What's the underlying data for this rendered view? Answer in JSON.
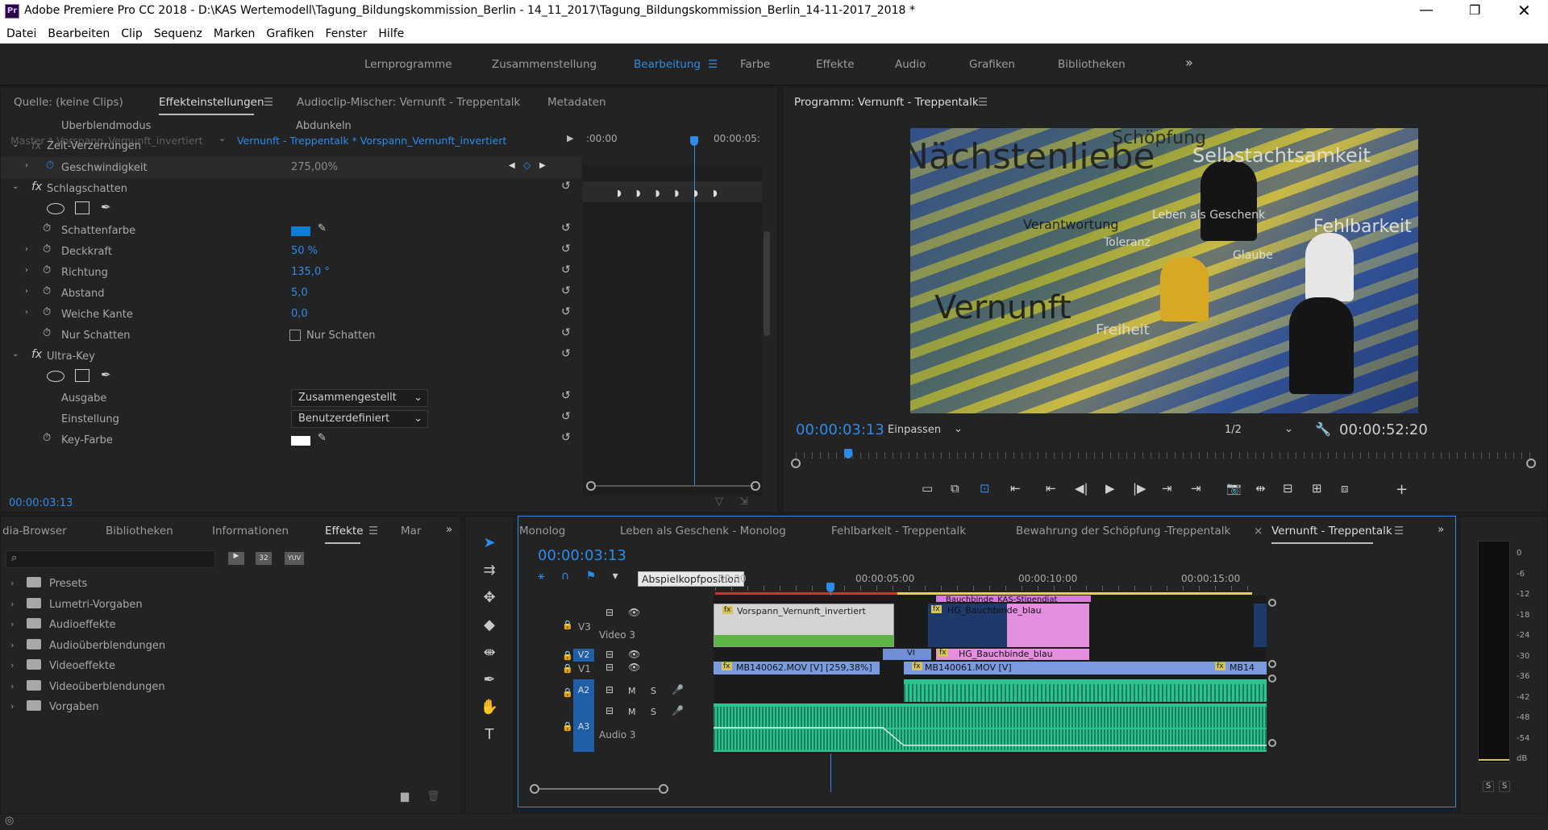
{
  "window": {
    "title": "Adobe Premiere Pro CC 2018 - D:\\KAS Wertemodell\\Tagung_Bildungskommission_Berlin - 14_11_2017\\Tagung_Bildungskommission_Berlin_14-11-2017_2018 *",
    "app_icon": "Pr"
  },
  "menu": [
    "Datei",
    "Bearbeiten",
    "Clip",
    "Sequenz",
    "Marken",
    "Grafiken",
    "Fenster",
    "Hilfe"
  ],
  "workspaces": [
    "Lernprogramme",
    "Zusammenstellung",
    "Bearbeitung",
    "Farbe",
    "Effekte",
    "Audio",
    "Grafiken",
    "Bibliotheken"
  ],
  "workspace_active": "Bearbeitung",
  "source_panel": {
    "tabs": [
      "Quelle: (keine Clips)",
      "Effekteinstellungen",
      "Audioclip-Mischer: Vernunft - Treppentalk",
      "Metadaten"
    ],
    "master_label": "Master * Vorspann_Vernunft_invertiert",
    "clip_label": "Vernunft - Treppentalk * Vorspann_Vernunft_invertiert",
    "time_start": ":00:00",
    "time_end": "00:00:05:",
    "rows": {
      "ueberblendmodus_label": "Überblendmodus",
      "ueberblendmodus_value": "Abdunkeln",
      "zeit_verzerrungen": "Zeit-Verzerrungen",
      "geschwindigkeit_label": "Geschwindigkeit",
      "geschwindigkeit_value": "275,00%",
      "schlagschatten": "Schlagschatten",
      "schattenfarbe": "Schattenfarbe",
      "deckkraft_label": "Deckkraft",
      "deckkraft_value": "50 %",
      "richtung_label": "Richtung",
      "richtung_value": "135,0 °",
      "abstand_label": "Abstand",
      "abstand_value": "5,0",
      "weiche_kante_label": "Weiche Kante",
      "weiche_kante_value": "0,0",
      "nur_schatten_label": "Nur Schatten",
      "nur_schatten_value": "Nur Schatten",
      "ultra_key": "Ultra-Key",
      "ausgabe_label": "Ausgabe",
      "ausgabe_value": "Zusammengestellt",
      "einstellung_label": "Einstellung",
      "einstellung_value": "Benutzerdefiniert",
      "key_farbe_label": "Key-Farbe"
    },
    "timecode": "00:00:03:13",
    "shadow_color": "#0a7fd4"
  },
  "program_panel": {
    "title": "Programm: Vernunft - Treppentalk",
    "timecode": "00:00:03:13",
    "fit": "Einpassen",
    "resolution": "1/2",
    "duration": "00:00:52:20",
    "playhead_fraction": 0.066
  },
  "effects_panel": {
    "tabs": [
      "dia-Browser",
      "Bibliotheken",
      "Informationen",
      "Effekte",
      "Mar"
    ],
    "active_tab": "Effekte",
    "search_placeholder": "",
    "folders": [
      "Presets",
      "Lumetri-Vorgaben",
      "Audioeffekte",
      "Audioüberblendungen",
      "Videoeffekte",
      "Videoüberblendungen",
      "Vorgaben"
    ],
    "badges": [
      "32",
      "YUV"
    ]
  },
  "timeline": {
    "tabs": [
      "Monolog",
      "Leben als Geschenk - Monolog",
      "Fehlbarkeit - Treppentalk",
      "Bewahrung der Schöpfung -Treppentalk",
      "Vernunft - Treppentalk"
    ],
    "active_tab": "Vernunft - Treppentalk",
    "timecode": "00:00:03:13",
    "tooltip": "Abspielkopfposition",
    "ruler": [
      ":00:00",
      "00:00:05:00",
      "00:00:10:00",
      "00:00:15:00"
    ],
    "tracks": {
      "v3": "V3",
      "video3": "Video 3",
      "v2": "V2",
      "v1": "V1",
      "a2": "A2",
      "a3": "A3",
      "audio3": "Audio 3",
      "mute": "M",
      "solo": "S"
    },
    "clips": {
      "vorspann": "Vorspann_Vernunft_invertiert",
      "bauchbinde_top": "Bauchbinde_KAS-Stipendiat",
      "hg_blau_1": "HG_Bauchbinde_blau",
      "hg_blau_2": "HG_Bauchbinde_blau",
      "vi_short": "VI",
      "mb62": "MB140062.MOV [V] [259,38%]",
      "mb61": "MB140061.MOV [V]",
      "mb14": "MB14"
    }
  },
  "meter": {
    "scale": [
      "0",
      "-6",
      "-12",
      "-18",
      "-24",
      "-30",
      "-36",
      "-42",
      "-48",
      "-54",
      "dB"
    ],
    "solo_buttons": [
      "S",
      "S"
    ]
  },
  "video_words": [
    "Nächstenliebe",
    "Schöpfung",
    "Selbstachtsamkeit",
    "Verantwortung",
    "Leben als Geschenk",
    "Toleranz",
    "Glaube",
    "Fehlbarkeit",
    "Freiheit",
    "Vernunft"
  ]
}
